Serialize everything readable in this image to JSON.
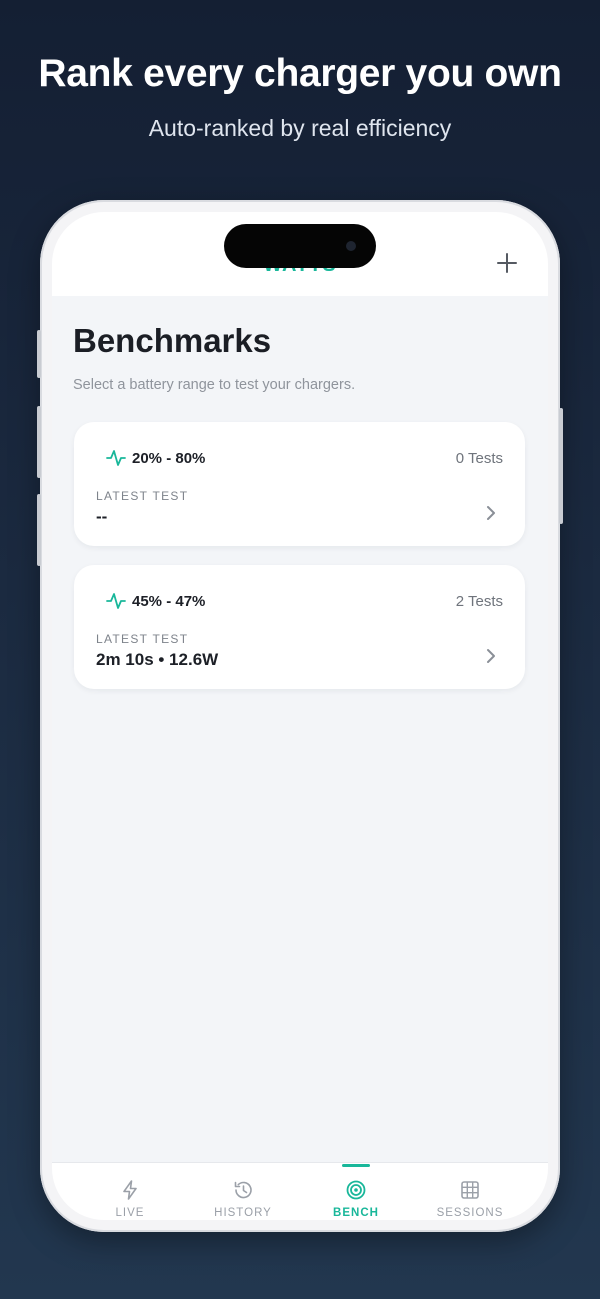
{
  "promo": {
    "headline": "Rank every charger you own",
    "subline": "Auto-ranked by real efficiency"
  },
  "app": {
    "name": "WATTS",
    "add_icon": "plus-icon"
  },
  "page": {
    "title": "Benchmarks",
    "subtitle": "Select a battery range to test your chargers."
  },
  "benchmarks": [
    {
      "range": "20% - 80%",
      "tests": "0 Tests",
      "latest_label": "LATEST TEST",
      "latest_value": "--",
      "icon": "pulse-icon"
    },
    {
      "range": "45% - 47%",
      "tests": "2 Tests",
      "latest_label": "LATEST TEST",
      "latest_value": "2m 10s • 12.6W",
      "icon": "pulse-icon"
    }
  ],
  "tabs": [
    {
      "label": "LIVE",
      "icon": "bolt-icon",
      "active": false
    },
    {
      "label": "HISTORY",
      "icon": "history-icon",
      "active": false
    },
    {
      "label": "BENCH",
      "icon": "target-icon",
      "active": true
    },
    {
      "label": "SESSIONS",
      "icon": "grid-icon",
      "active": false
    }
  ],
  "colors": {
    "accent": "#19b79a",
    "background": "#1b2a40",
    "screen_bg": "#f3f5f8"
  }
}
